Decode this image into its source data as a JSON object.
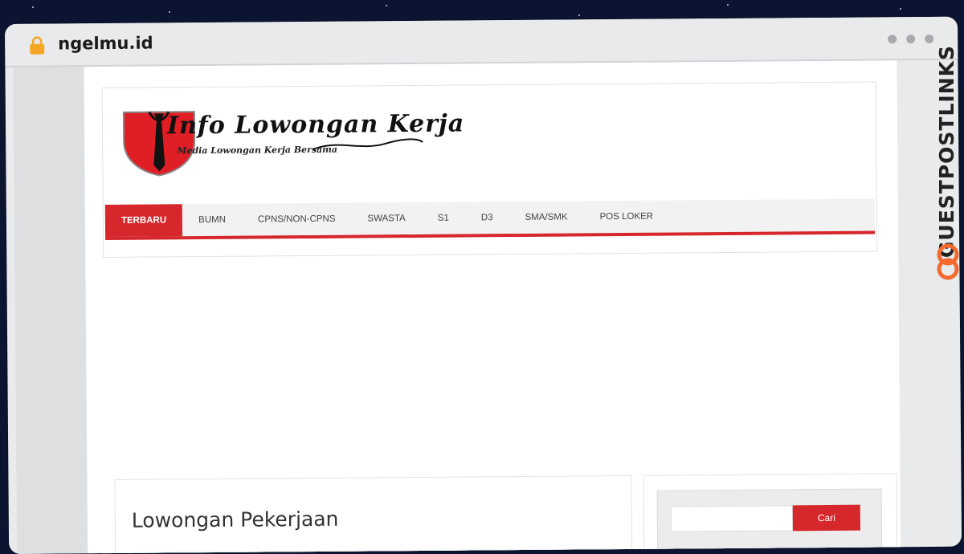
{
  "browser": {
    "url": "ngelmu.id",
    "lock_icon": "lock-icon",
    "window_controls": [
      "dot-icon",
      "dot-icon",
      "dot-icon"
    ]
  },
  "site": {
    "logo": {
      "title": "Info Lowongan Kerja",
      "subtitle": "Media Lowongan Kerja Bersama",
      "colors": {
        "shield": "#e01e26",
        "tie": "#111111"
      }
    },
    "nav": {
      "items": [
        {
          "label": "TERBARU",
          "active": true
        },
        {
          "label": "BUMN"
        },
        {
          "label": "CPNS/NON-CPNS"
        },
        {
          "label": "SWASTA"
        },
        {
          "label": "S1"
        },
        {
          "label": "D3"
        },
        {
          "label": "SMA/SMK"
        },
        {
          "label": "POS LOKER"
        }
      ],
      "accent_color": "#d6282c"
    },
    "main": {
      "title": "Lowongan Pekerjaan"
    },
    "sidebar": {
      "search": {
        "value": "",
        "placeholder": "",
        "button_label": "Cari"
      }
    }
  },
  "watermark": {
    "text": "GUESTPOSTLINKS",
    "icon": "link-icon",
    "color": "#f26a2e"
  }
}
